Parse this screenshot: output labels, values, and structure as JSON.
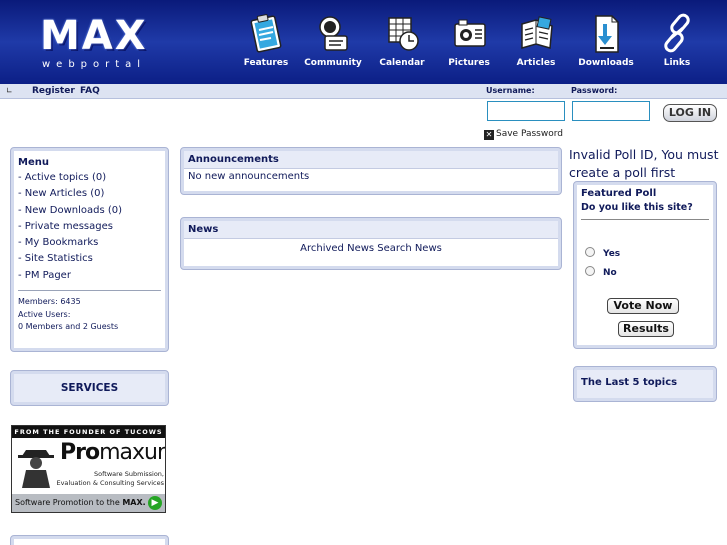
{
  "header": {
    "logo_main": "MAX",
    "logo_sub": "webportal",
    "nav": [
      {
        "label": "Features",
        "icon": "clipboard-icon"
      },
      {
        "label": "Community",
        "icon": "community-icon"
      },
      {
        "label": "Calendar",
        "icon": "calendar-icon"
      },
      {
        "label": "Pictures",
        "icon": "camera-icon"
      },
      {
        "label": "Articles",
        "icon": "articles-icon"
      },
      {
        "label": "Downloads",
        "icon": "download-icon"
      },
      {
        "label": "Links",
        "icon": "chain-link-icon"
      }
    ]
  },
  "topbar": {
    "register": "Register",
    "faq": "FAQ",
    "username_label": "Username:",
    "password_label": "Password:",
    "login_button": "LOG IN",
    "save_password": "Save Password"
  },
  "menu": {
    "title": "Menu",
    "items": [
      "- Active topics (0)",
      "- New Articles (0)",
      "- New Downloads (0)",
      "- Private messages",
      "- My Bookmarks",
      "- Site Statistics",
      "- PM Pager"
    ],
    "members": "Members: 6435",
    "active_users_label": "Active Users:",
    "active_users": "0 Members and 2 Guests"
  },
  "services": {
    "title": "SERVICES"
  },
  "promo": {
    "top": "FROM THE FOUNDER OF TUCOWS",
    "brand_bold": "Pro",
    "brand_rest": "maxum",
    "sub1": "Software Submission,",
    "sub2": "Evaluation & Consulting Services",
    "bottom_prefix": "Software Promotion to the",
    "bottom_bold": "MAX."
  },
  "announcements": {
    "title": "Announcements",
    "text": "No new announcements"
  },
  "news": {
    "title": "News",
    "archived": "Archived News",
    "search": "Search News"
  },
  "poll": {
    "message": "Invalid Poll ID, You must create a poll first",
    "title": "Featured Poll",
    "question": "Do you like this site?",
    "options": [
      "Yes",
      "No"
    ],
    "vote_button": "Vote Now",
    "results_button": "Results"
  },
  "last_topics": {
    "title": "The Last 5 topics"
  },
  "colors": {
    "header_blue": "#1f3aa8",
    "panel_border": "#aab4d4",
    "text_navy": "#101a5a"
  }
}
